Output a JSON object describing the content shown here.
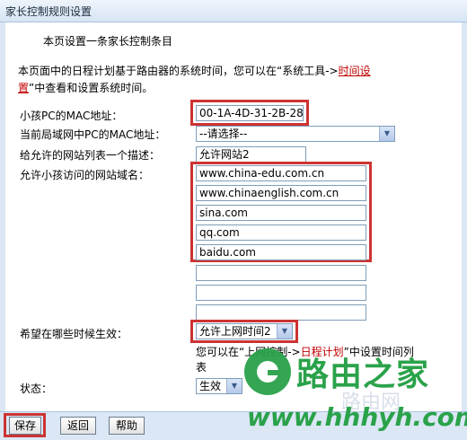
{
  "window": {
    "title": "家长控制规则设置"
  },
  "intro": "本页设置一条家长控制条目",
  "description": {
    "text_before": "本页面中的日程计划基于路由器的系统时间，您可以在“系统工具->",
    "link_line1": "时间设",
    "link_line2": "置",
    "text_after": "”中查看和设置系统时间。"
  },
  "form": {
    "child_mac_label": "小孩PC的MAC地址：",
    "child_mac_value": "00-1A-4D-31-2B-28",
    "lan_mac_label": "当前局域网中PC的MAC地址：",
    "lan_mac_value": "--请选择--",
    "desc_label": "给允许的网站列表一个描述：",
    "desc_value": "允许网站2",
    "domains_label": "允许小孩访问的网站域名：",
    "domains": [
      "www.china-edu.com.cn",
      "www.chinaenglish.com.cn",
      "sina.com",
      "qq.com",
      "baidu.com",
      "",
      "",
      ""
    ],
    "time_label": "希望在哪些时候生效：",
    "time_value": "允许上网时间2",
    "time_note_a": "您可以在“上网控制->",
    "time_note_link": "日程计划",
    "time_note_b": "”中设置时间列",
    "time_note_c": "表",
    "status_label": "状态：",
    "status_value": "生效"
  },
  "buttons": {
    "save": "保存",
    "back": "返回",
    "help": "帮助"
  },
  "watermark": {
    "brand": "路由之家",
    "url": "www.hhhyh.com",
    "faint": "路由网"
  }
}
